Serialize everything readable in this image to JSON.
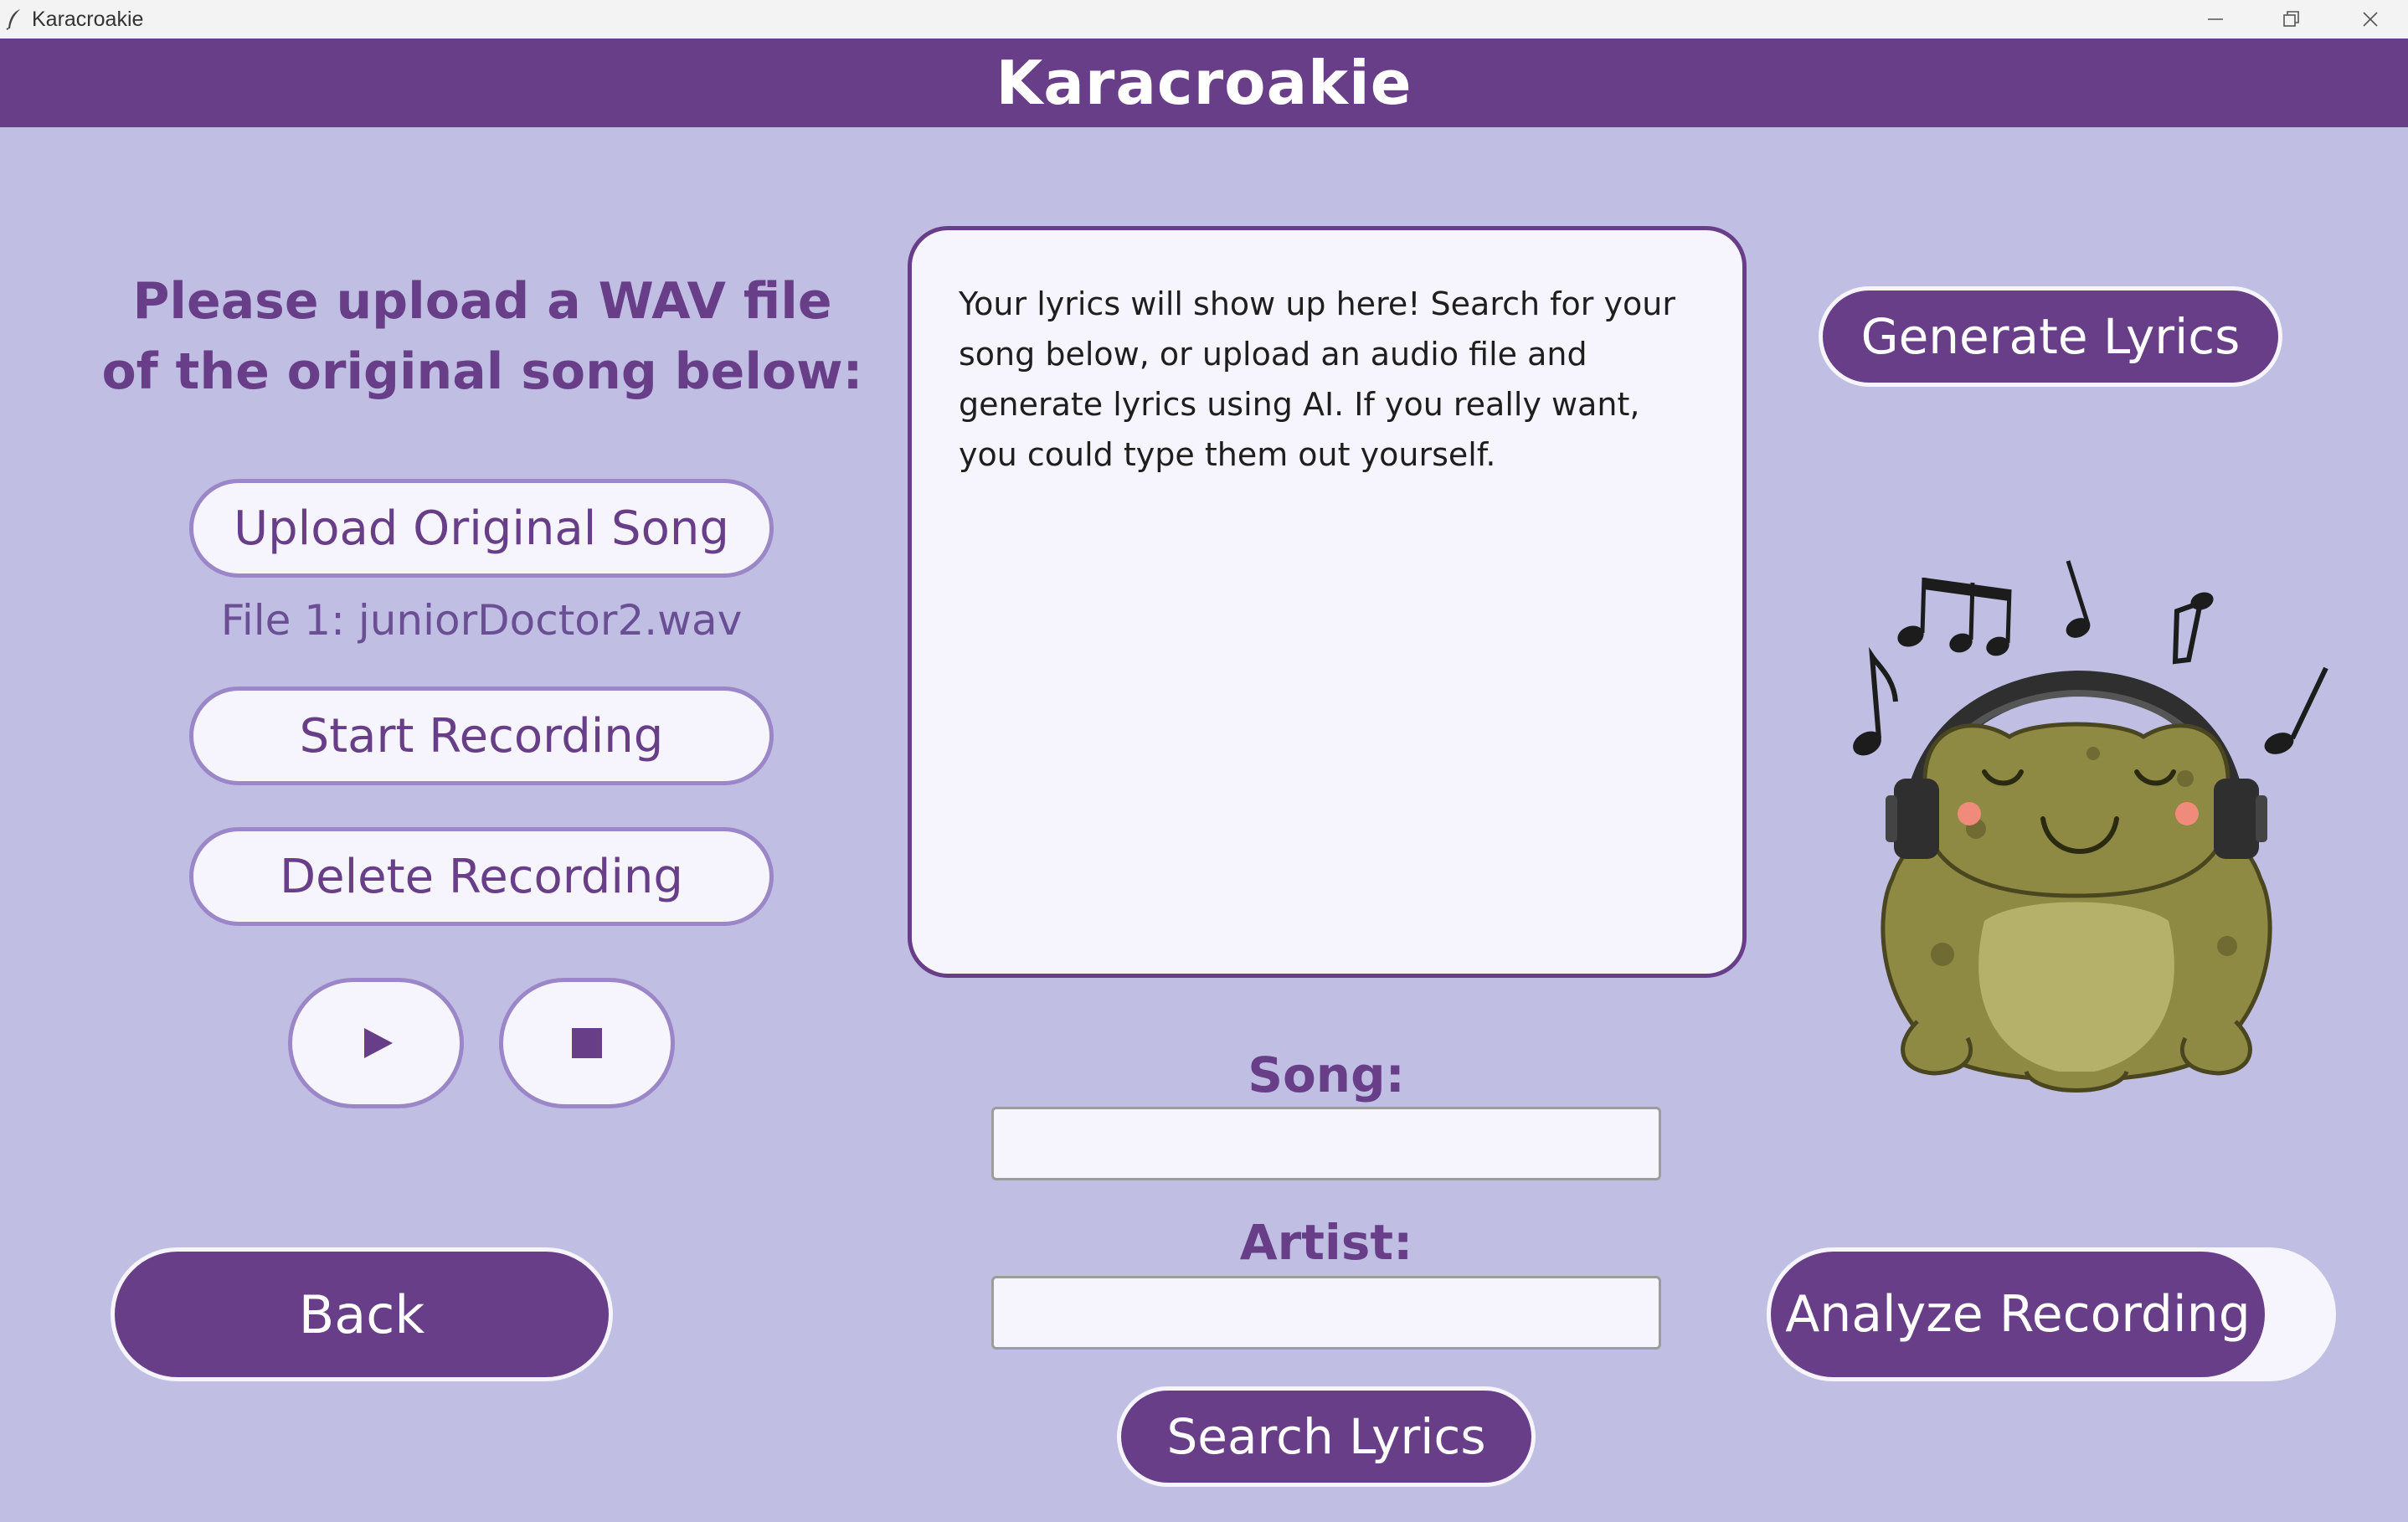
{
  "window": {
    "title": "Karacroakie"
  },
  "header": {
    "title": "Karacroakie"
  },
  "left_panel": {
    "instruction": "Please upload a WAV file of the original song below:",
    "upload_button": "Upload Original Song",
    "file_label": "File 1: juniorDoctor2.wav",
    "start_recording_button": "Start Recording",
    "delete_recording_button": "Delete Recording",
    "play_icon": "play-icon",
    "stop_icon": "stop-icon",
    "back_button": "Back"
  },
  "lyrics": {
    "text": "Your lyrics will show up here! Search for your song below, or upload an audio file and generate lyrics using AI. If you really want, you could type them out yourself."
  },
  "search": {
    "song_label": "Song:",
    "song_value": "",
    "artist_label": "Artist:",
    "artist_value": "",
    "search_button": "Search Lyrics"
  },
  "right_panel": {
    "generate_button": "Generate Lyrics",
    "analyze_button": "Analyze Recording",
    "mascot": "frog-with-headphones-illustration"
  },
  "colors": {
    "primary_purple": "#673e87",
    "background_lavender": "#c0bee3",
    "button_light": "#f6f5fd",
    "button_border": "#9b86c7"
  }
}
